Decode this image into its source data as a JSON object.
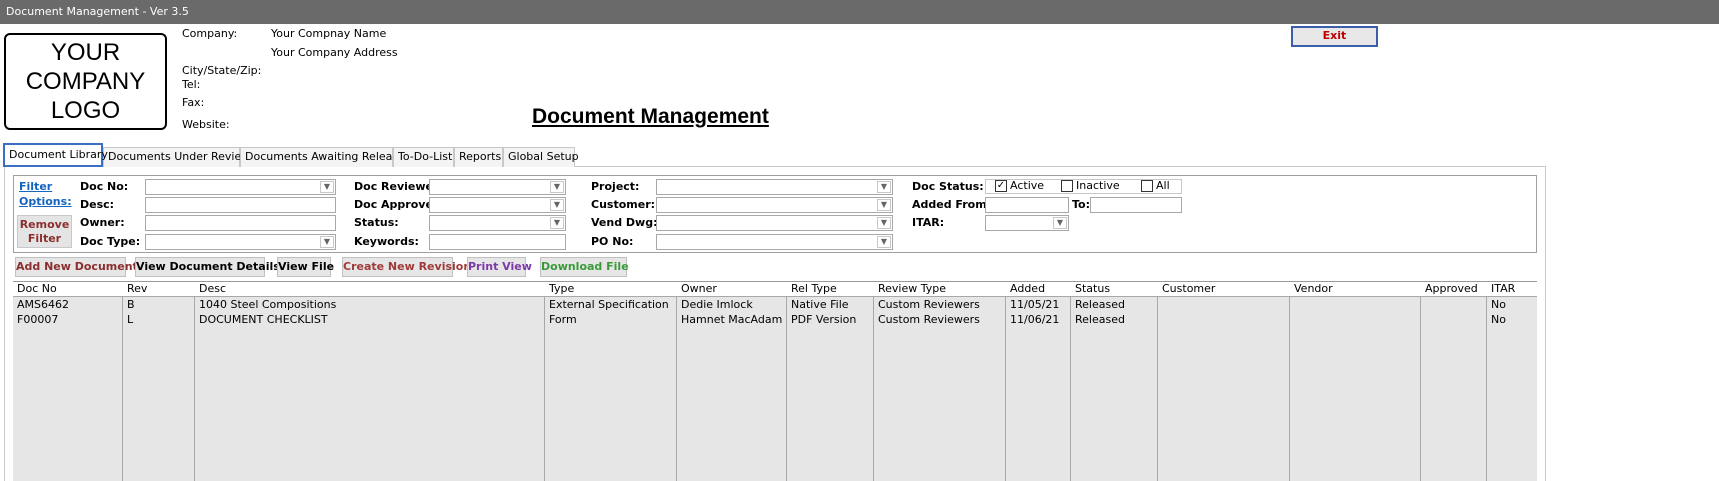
{
  "window": {
    "title": "Document Management - Ver 3.5"
  },
  "logo": {
    "text": "YOUR\nCOMPANY\nLOGO"
  },
  "company_info": {
    "company_label": "Company:",
    "company_name": "Your Compnay Name",
    "company_address": "Your Company Address",
    "city_label": "City/State/Zip:",
    "tel_label": "Tel:",
    "fax_label": "Fax:",
    "website_label": "Website:"
  },
  "header": {
    "exit_label": "Exit",
    "page_title": "Document Management"
  },
  "tabs": [
    {
      "label": "Document Library",
      "active": true
    },
    {
      "label": "Documents Under Review",
      "active": false
    },
    {
      "label": "Documents Awaiting Release",
      "active": false
    },
    {
      "label": "To-Do-List",
      "active": false
    },
    {
      "label": "Reports",
      "active": false
    },
    {
      "label": "Global Setup",
      "active": false
    }
  ],
  "filters": {
    "filter_options_line1": "Filter",
    "filter_options_line2": "Options:",
    "remove_filter_line1": "Remove",
    "remove_filter_line2": "Filter",
    "doc_no": "Doc No:",
    "desc": "Desc:",
    "owner": "Owner:",
    "doc_type": "Doc Type:",
    "doc_reviewer": "Doc Reviewer:",
    "doc_approver": "Doc Approver:",
    "status": "Status:",
    "keywords": "Keywords:",
    "project": "Project:",
    "customer": "Customer:",
    "vend_dwg": "Vend Dwg:",
    "po_no": "PO No:",
    "doc_status": "Doc Status:",
    "added_from": "Added From:",
    "to": "To:",
    "itar": "ITAR:",
    "status_active": "Active",
    "status_inactive": "Inactive",
    "status_all": "All",
    "active_checked": true,
    "inactive_checked": false,
    "all_checked": false
  },
  "actions": {
    "add_new_document": "Add New Document",
    "view_document_details": "View Document Details",
    "view_file": "View File",
    "create_new_revision": "Create New Revision",
    "print_view": "Print View",
    "download_file": "Download File"
  },
  "colors": {
    "add_new_document": "#8b2e2e",
    "create_new_revision": "#a03a3a",
    "print_view": "#7a3aa8",
    "download_file": "#3a9a3a",
    "exit": "#c00000",
    "link": "#1565c0"
  },
  "table": {
    "columns": [
      "Doc No",
      "Rev",
      "Desc",
      "Type",
      "Owner",
      "Rel Type",
      "Review Type",
      "Added",
      "Status",
      "Customer",
      "Vendor",
      "Approved",
      "ITAR"
    ],
    "rows": [
      [
        "AMS6462",
        "B",
        "1040 Steel Compositions",
        "External Specification",
        "Dedie Imlock",
        "Native File",
        "Custom Reviewers",
        "11/05/21",
        "Released",
        "",
        "",
        "",
        "No"
      ],
      [
        "F00007",
        "L",
        "DOCUMENT CHECKLIST",
        "Form",
        "Hamnet MacAdam",
        "PDF Version",
        "Custom Reviewers",
        "11/06/21",
        "Released",
        "",
        "",
        "",
        "No"
      ]
    ]
  }
}
